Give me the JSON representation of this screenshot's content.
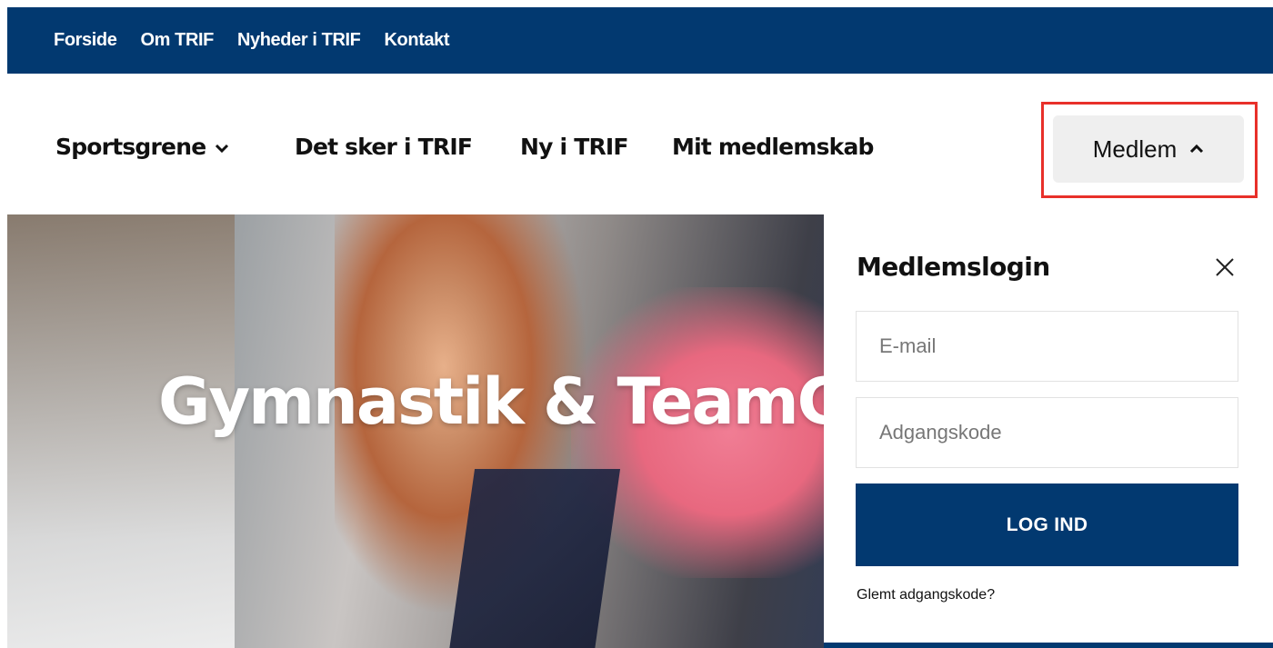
{
  "top_nav": {
    "items": [
      {
        "label": "Forside"
      },
      {
        "label": "Om TRIF"
      },
      {
        "label": "Nyheder i TRIF"
      },
      {
        "label": "Kontakt"
      }
    ]
  },
  "main_nav": {
    "sportsgrene": "Sportsgrene",
    "det_sker": "Det sker i TRIF",
    "ny_i_trif": "Ny i TRIF",
    "mit_medlemskab": "Mit medlemskab",
    "medlem": "Medlem"
  },
  "hero": {
    "title": "Gymnastik & TeamG"
  },
  "login": {
    "title": "Medlemslogin",
    "email_placeholder": "E-mail",
    "password_placeholder": "Adgangskode",
    "submit_label": "LOG IND",
    "forgot_label": "Glemt adgangskode?"
  },
  "icons": {
    "dropdown": "chevron-down-icon",
    "collapse": "chevron-up-icon",
    "close": "close-icon"
  },
  "colors": {
    "brand": "#023970",
    "highlight": "#e8302a",
    "button_bg": "#efefef"
  }
}
